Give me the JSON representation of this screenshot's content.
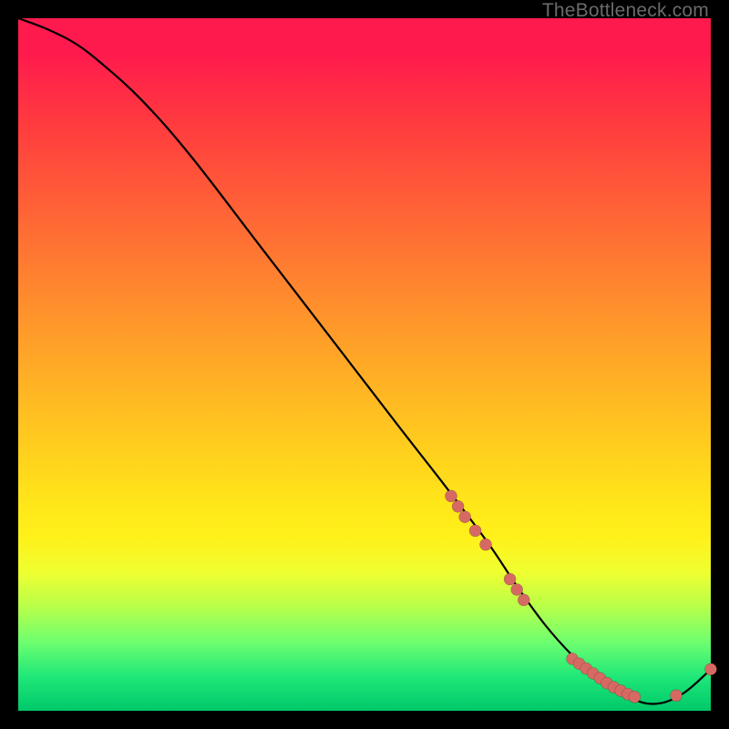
{
  "watermark": "TheBottleneck.com",
  "chart_data": {
    "type": "line",
    "title": "",
    "xlabel": "",
    "ylabel": "",
    "xlim": [
      0,
      100
    ],
    "ylim": [
      0,
      100
    ],
    "grid": false,
    "series": [
      {
        "name": "bottleneck-curve",
        "x": [
          0,
          4,
          8,
          12,
          18,
          25,
          35,
          45,
          55,
          62,
          68,
          72,
          76,
          80,
          84,
          88,
          92,
          96,
          100
        ],
        "y": [
          100,
          98.5,
          96.5,
          93.5,
          88,
          80,
          67,
          54,
          41,
          32,
          24,
          18,
          12.5,
          8,
          4.5,
          2,
          1,
          2.5,
          6
        ]
      }
    ],
    "markers": {
      "name": "highlight-points",
      "points": [
        {
          "x": 62.5,
          "y": 31
        },
        {
          "x": 63.5,
          "y": 29.5
        },
        {
          "x": 64.5,
          "y": 28
        },
        {
          "x": 66,
          "y": 26
        },
        {
          "x": 67.5,
          "y": 24
        },
        {
          "x": 71,
          "y": 19
        },
        {
          "x": 72,
          "y": 17.5
        },
        {
          "x": 73,
          "y": 16
        },
        {
          "x": 80,
          "y": 7.5
        },
        {
          "x": 81,
          "y": 6.8
        },
        {
          "x": 82,
          "y": 6.1
        },
        {
          "x": 83,
          "y": 5.4
        },
        {
          "x": 84,
          "y": 4.7
        },
        {
          "x": 85,
          "y": 4.0
        },
        {
          "x": 86,
          "y": 3.4
        },
        {
          "x": 87,
          "y": 2.9
        },
        {
          "x": 88,
          "y": 2.4
        },
        {
          "x": 89,
          "y": 2.0
        },
        {
          "x": 95,
          "y": 2.2
        },
        {
          "x": 100,
          "y": 6.0
        }
      ]
    },
    "colors": {
      "curve": "#000000",
      "marker": "#d66a63",
      "gradient_top": "#ff1a4d",
      "gradient_bottom": "#00c86a",
      "background_outer": "#000000"
    }
  }
}
